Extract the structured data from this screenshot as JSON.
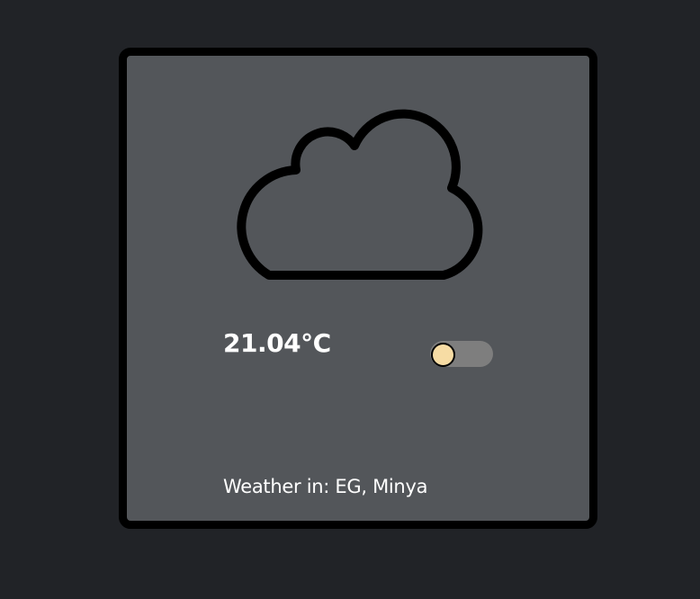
{
  "weather": {
    "icon": "cloud-icon",
    "temperature": "21.04°C",
    "unit_toggle": {
      "state": "off",
      "knob_color": "#f7dca4",
      "track_color": "#7e7e7e"
    },
    "location": "Weather in: EG, Minya"
  },
  "colors": {
    "background": "#212327",
    "card": "#53565a",
    "border": "#000000",
    "text": "#ffffff"
  }
}
